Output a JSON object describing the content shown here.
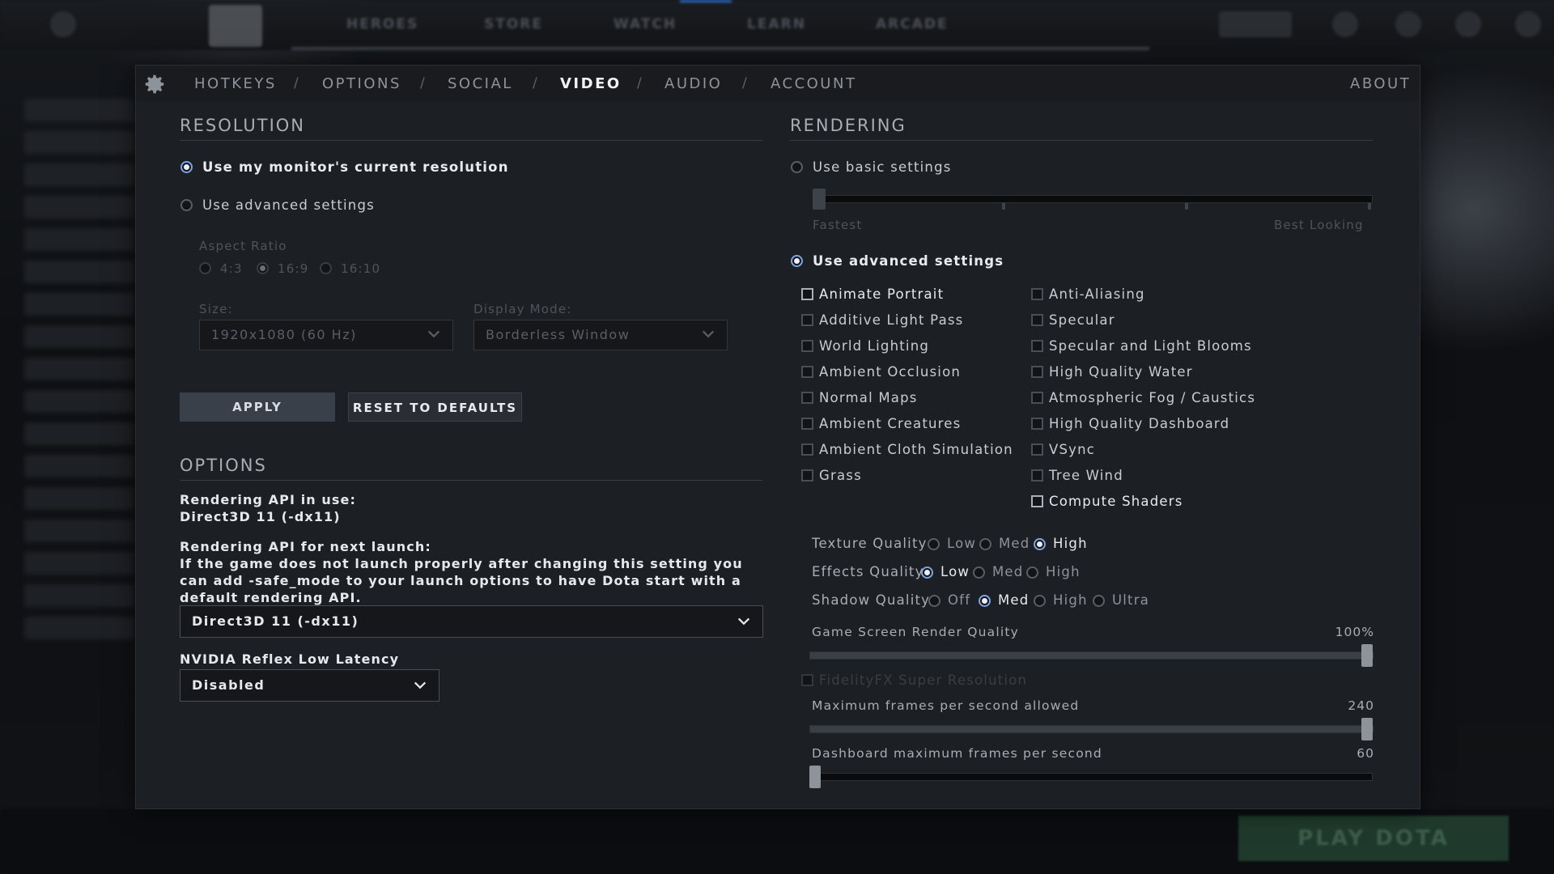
{
  "topnav": [
    "HEROES",
    "STORE",
    "WATCH",
    "LEARN",
    "ARCADE"
  ],
  "tabs": {
    "items": [
      "HOTKEYS",
      "OPTIONS",
      "SOCIAL",
      "VIDEO",
      "AUDIO",
      "ACCOUNT"
    ],
    "active": "VIDEO",
    "about": "ABOUT"
  },
  "resolution": {
    "title": "RESOLUTION",
    "use_monitor": "Use my monitor's current resolution",
    "use_advanced": "Use advanced settings",
    "aspect_ratio_label": "Aspect Ratio",
    "aspect_options": [
      "4:3",
      "16:9",
      "16:10"
    ],
    "aspect_selected": "16:9",
    "size_label": "Size:",
    "size_value": "1920x1080 (60 Hz)",
    "display_mode_label": "Display Mode:",
    "display_mode_value": "Borderless Window",
    "apply": "APPLY",
    "reset": "RESET TO DEFAULTS"
  },
  "options": {
    "title": "OPTIONS",
    "api_in_use_label": "Rendering API in use:",
    "api_in_use_value": "Direct3D 11 (-dx11)",
    "api_next_label": "Rendering API for next launch:",
    "api_next_help": "If the game does not launch properly after changing this setting you can add -safe_mode to your launch options to have Dota start with a default rendering API.",
    "api_next_value": "Direct3D 11 (-dx11)",
    "reflex_label": "NVIDIA Reflex Low Latency",
    "reflex_value": "Disabled"
  },
  "rendering": {
    "title": "RENDERING",
    "use_basic": "Use basic settings",
    "fastest": "Fastest",
    "best_looking": "Best Looking",
    "use_advanced": "Use advanced settings",
    "checks_left": [
      {
        "label": "Animate Portrait",
        "checked": false
      },
      {
        "label": "Additive Light Pass",
        "checked": false
      },
      {
        "label": "World Lighting",
        "checked": false
      },
      {
        "label": "Ambient Occlusion",
        "checked": false
      },
      {
        "label": "Normal Maps",
        "checked": false
      },
      {
        "label": "Ambient Creatures",
        "checked": false
      },
      {
        "label": "Ambient Cloth Simulation",
        "checked": false
      },
      {
        "label": "Grass",
        "checked": false
      }
    ],
    "checks_right": [
      {
        "label": "Anti-Aliasing",
        "checked": false
      },
      {
        "label": "Specular",
        "checked": false
      },
      {
        "label": "Specular and Light Blooms",
        "checked": false
      },
      {
        "label": "High Quality Water",
        "checked": false
      },
      {
        "label": "Atmospheric Fog / Caustics",
        "checked": false
      },
      {
        "label": "High Quality Dashboard",
        "checked": false
      },
      {
        "label": "VSync",
        "checked": false
      },
      {
        "label": "Tree Wind",
        "checked": false
      },
      {
        "label": "Compute Shaders",
        "checked": false
      }
    ],
    "texture_quality": {
      "label": "Texture Quality",
      "options": [
        "Low",
        "Med",
        "High"
      ],
      "selected": "High"
    },
    "effects_quality": {
      "label": "Effects Quality",
      "options": [
        "Low",
        "Med",
        "High"
      ],
      "selected": "Low"
    },
    "shadow_quality": {
      "label": "Shadow Quality",
      "options": [
        "Off",
        "Med",
        "High",
        "Ultra"
      ],
      "selected": "Med"
    },
    "render_quality": {
      "label": "Game Screen Render Quality",
      "value": "100%",
      "fraction": 1.0
    },
    "fsr": "FidelityFX Super Resolution",
    "max_fps": {
      "label": "Maximum frames per second allowed",
      "value": "240",
      "fraction": 1.0
    },
    "dashboard_fps": {
      "label": "Dashboard maximum frames per second",
      "value": "60",
      "fraction": 0.0
    }
  },
  "play_button": "PLAY DOTA"
}
